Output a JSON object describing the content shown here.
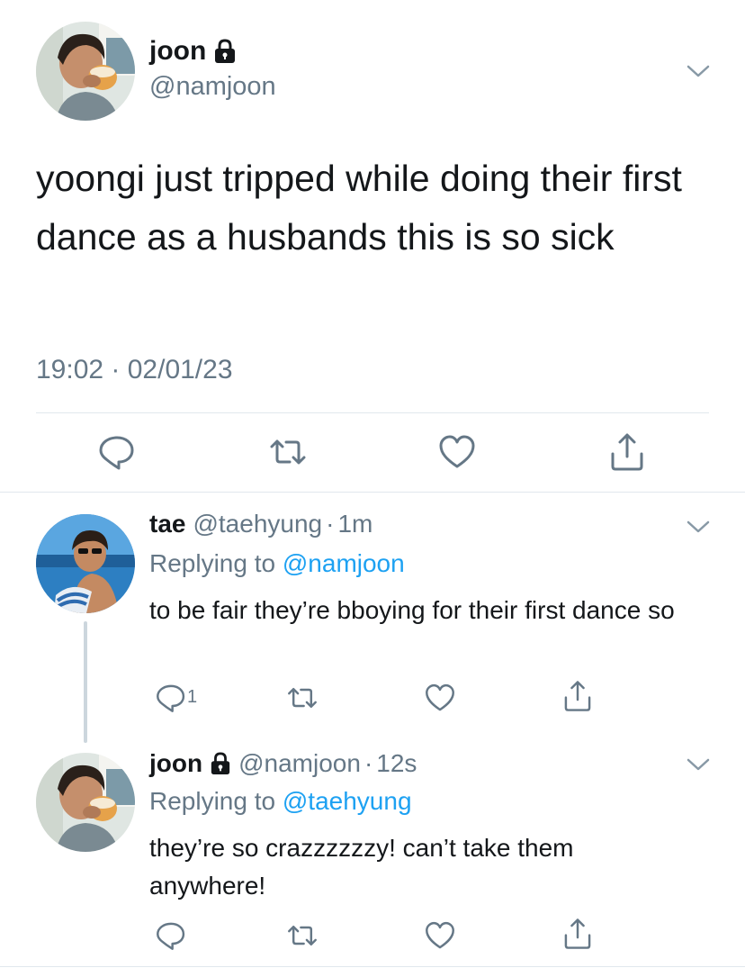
{
  "main_tweet": {
    "display_name": "joon",
    "handle": "@namjoon",
    "text": "yoongi just tripped while doing their first dance as a husbands this is so sick",
    "timestamp": "19:02 · 02/01/23",
    "avatar_icon": "avatar-photo-drinking",
    "protected_icon": "lock-icon"
  },
  "replies": [
    {
      "display_name": "tae",
      "handle": "@taehyung",
      "time": "1m",
      "separator": "·",
      "replying_prefix": "Replying to ",
      "replying_to": "@namjoon",
      "text": "to be fair they’re bboying for their first dance so",
      "reply_count": "1",
      "avatar_icon": "avatar-photo-beach"
    },
    {
      "display_name": "joon",
      "handle": "@namjoon",
      "time": "12s",
      "separator": "·",
      "replying_prefix": "Replying to ",
      "replying_to": "@taehyung",
      "text": "they’re so crazzzzzzy! can’t take them anywhere!",
      "reply_count": "",
      "avatar_icon": "avatar-photo-drinking"
    }
  ],
  "colors": {
    "text": "#14171a",
    "secondary": "#657786",
    "mention": "#1da1f2",
    "divider": "#e1e8ed",
    "icon": "#657786"
  }
}
